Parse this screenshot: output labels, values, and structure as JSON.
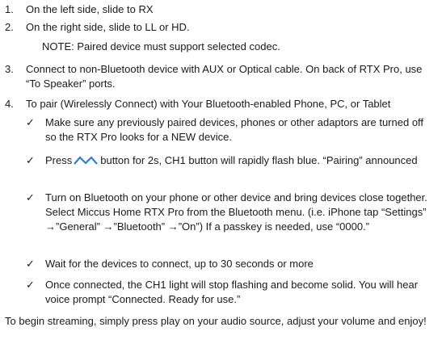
{
  "steps": [
    {
      "num": "1.",
      "text": "On the left side, slide to RX"
    },
    {
      "num": "2.",
      "text": "On the right side, slide to LL or HD."
    },
    {
      "num": "3.",
      "text": "Connect to non-Bluetooth device with AUX or Optical cable. On back of RTX Pro, use “To Speaker” ports."
    },
    {
      "num": "4.",
      "text": "To pair (Wirelessly Connect) with Your Bluetooth-enabled Phone, PC, or Tablet"
    }
  ],
  "note": "NOTE:  Paired device must support selected codec.",
  "checks": [
    {
      "mark": "✓",
      "text": "Make sure any previously paired devices, phones or other adaptors are turned off so the RTX Pro looks for a NEW device."
    },
    {
      "mark": "✓",
      "text_before": "Press",
      "icon": "pairing-wave-icon",
      "text_after": "button for 2s, CH1 button will rapidly flash blue.  “Pairing” announced"
    },
    {
      "mark": "✓",
      "text": "Turn on Bluetooth on your phone or other device and bring devices close together. Select Miccus Home RTX Pro from the Bluetooth menu.  (i.e. iPhone tap “Settings” →”General” →”Bluetooth” →”On”)   If a passkey is needed, use “0000.”"
    },
    {
      "mark": "✓",
      "text": "Wait for the devices to connect, up to 30 seconds or more"
    },
    {
      "mark": "✓",
      "text": "Once connected, the CH1 light will stop flashing and become solid.  You will hear voice prompt “Connected.  Ready for use.”"
    }
  ],
  "closing": "To begin streaming, simply press play on your audio source, adjust your volume and enjoy!",
  "colors": {
    "icon": "#2f7fd0",
    "text": "#1a1a1a"
  }
}
